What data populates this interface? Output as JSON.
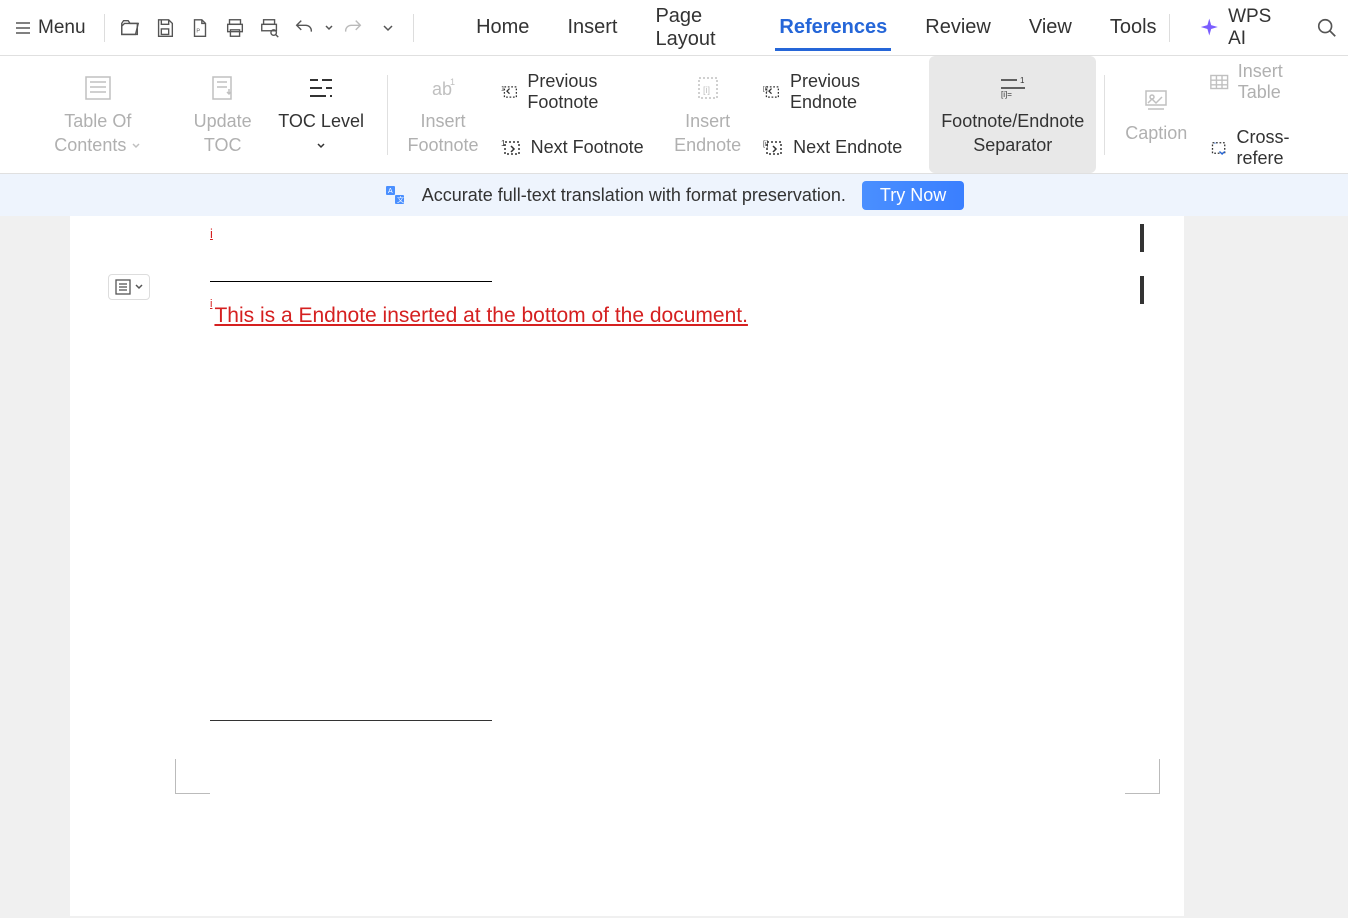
{
  "menu": {
    "label": "Menu"
  },
  "tabs": {
    "home": "Home",
    "insert": "Insert",
    "page_layout": "Page Layout",
    "references": "References",
    "review": "Review",
    "view": "View",
    "tools": "Tools"
  },
  "wps_ai": "WPS AI",
  "ribbon": {
    "toc": "Table Of Contents",
    "update_toc": "Update\nTOC",
    "toc_level": "TOC Level",
    "insert_footnote": "Insert\nFootnote",
    "prev_footnote": "Previous Footnote",
    "next_footnote": "Next Footnote",
    "insert_endnote": "Insert\nEndnote",
    "prev_endnote": "Previous Endnote",
    "next_endnote": "Next Endnote",
    "fe_separator": "Footnote/Endnote\nSeparator",
    "caption": "Caption",
    "insert_table": "Insert Table",
    "cross_ref": "Cross-refere"
  },
  "banner": {
    "text": "Accurate full-text translation with format preservation.",
    "try": "Try Now"
  },
  "document": {
    "endnote_marker": "i",
    "endnote_text": " This is a Endnote inserted at the bottom of the document."
  }
}
